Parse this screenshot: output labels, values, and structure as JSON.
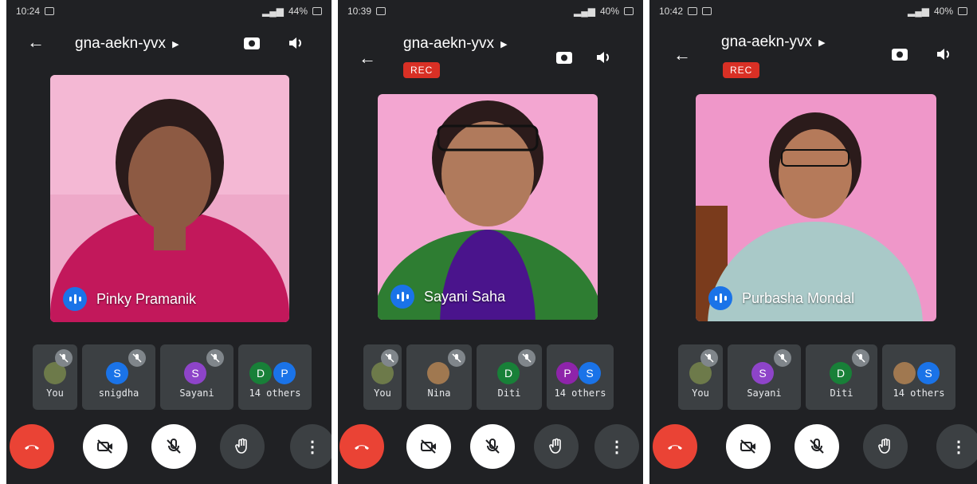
{
  "screens": [
    {
      "status": {
        "time": "10:24",
        "battery": "44%"
      },
      "meeting_code": "gna-aekn-yvx",
      "rec": "",
      "speaker": "Pinky Pramanik",
      "tiles": [
        {
          "label": "You",
          "avatar": ""
        },
        {
          "label": "snigdha",
          "avatar": "S"
        },
        {
          "label": "Sayani",
          "avatar": "S"
        },
        {
          "label": "14 others",
          "avatar": "D",
          "avatar2": "P"
        }
      ]
    },
    {
      "status": {
        "time": "10:39",
        "battery": "40%"
      },
      "meeting_code": "gna-aekn-yvx",
      "rec": "REC",
      "speaker": "Sayani Saha",
      "tiles": [
        {
          "label": "You",
          "avatar": ""
        },
        {
          "label": "Nina",
          "avatar": ""
        },
        {
          "label": "Diti",
          "avatar": "D"
        },
        {
          "label": "14 others",
          "avatar": "P",
          "avatar2": "S"
        }
      ]
    },
    {
      "status": {
        "time": "10:42",
        "battery": "40%"
      },
      "meeting_code": "gna-aekn-yvx",
      "rec": "REC",
      "speaker": "Purbasha Mondal",
      "tiles": [
        {
          "label": "You",
          "avatar": ""
        },
        {
          "label": "Sayani",
          "avatar": "S"
        },
        {
          "label": "Diti",
          "avatar": "D"
        },
        {
          "label": "14 others",
          "avatar": "",
          "avatar2": "S"
        }
      ]
    }
  ],
  "icons": {
    "back": "arrow-left-icon",
    "switch_camera": "switch-camera-icon",
    "speaker": "volume-icon",
    "end_call": "end-call-icon",
    "camera_off": "camera-off-icon",
    "mic_off": "mic-off-icon",
    "raise_hand": "raise-hand-icon",
    "more": "more-vertical-icon"
  },
  "colors": {
    "background": "#202124",
    "tile": "#3c4043",
    "speaking": "#1a73e8",
    "end_call": "#ea4335",
    "rec": "#d93025",
    "video_bg": "#f2a7cc"
  }
}
